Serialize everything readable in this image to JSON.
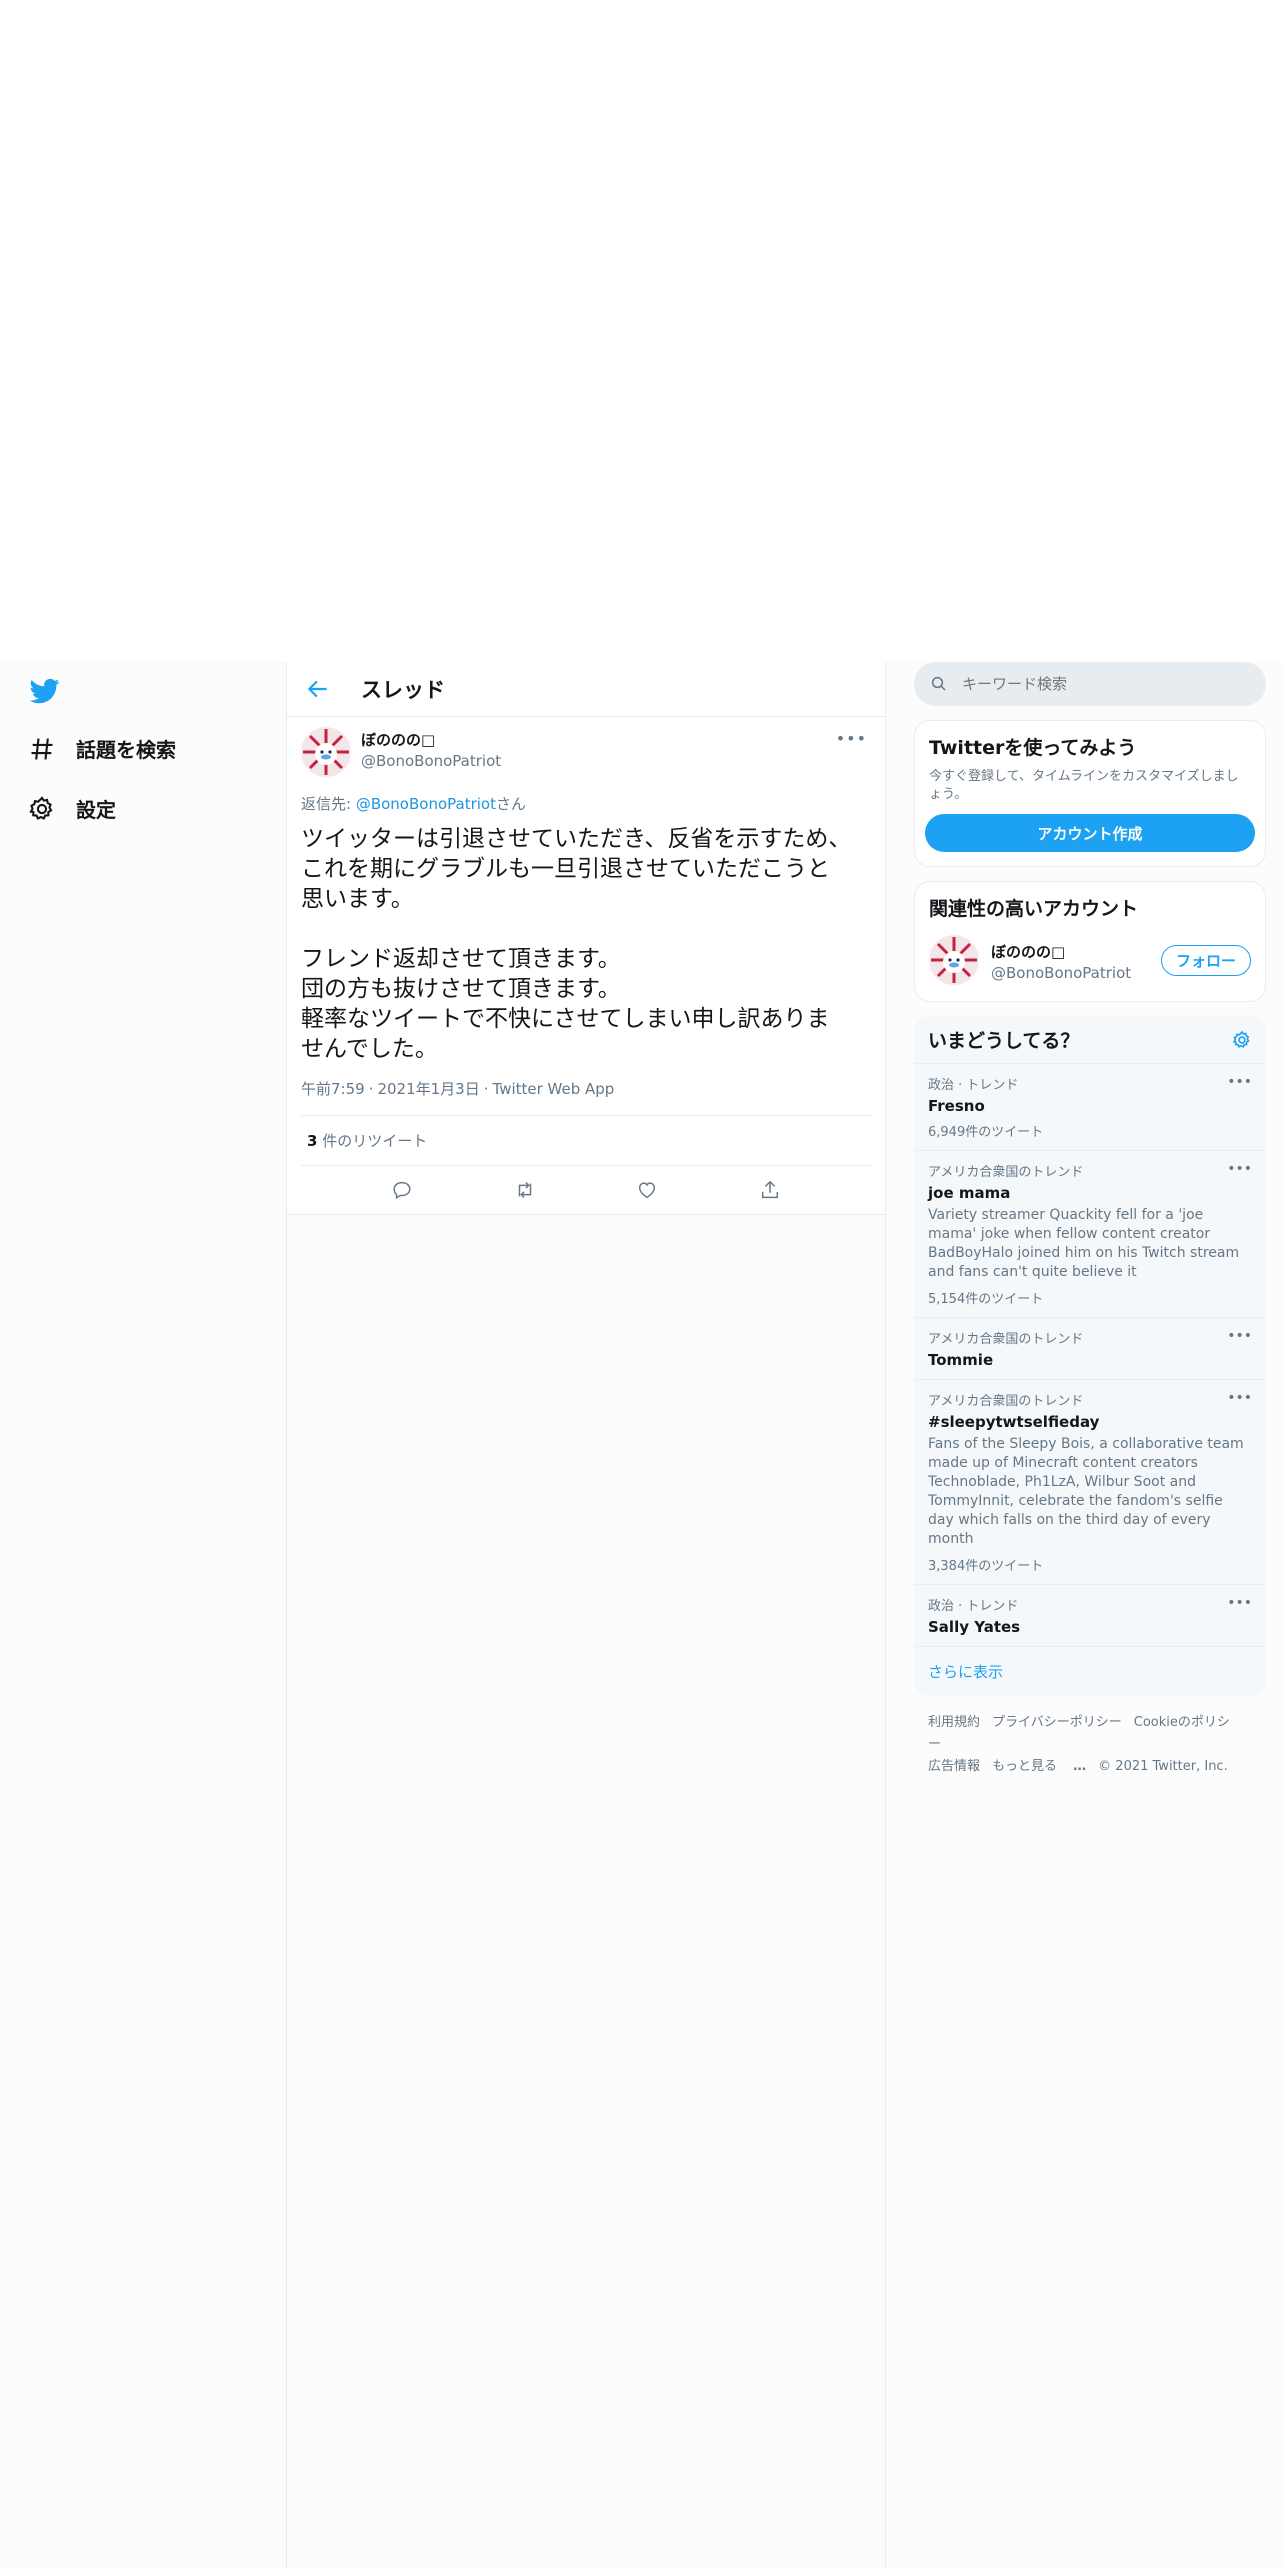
{
  "nav": {
    "explore_label": "話題を検索",
    "settings_label": "設定"
  },
  "thread": {
    "title": "スレッド"
  },
  "tweet": {
    "display_name": "ぼののの□",
    "handle": "@BonoBonoPatriot",
    "reply_prefix": "返信先: ",
    "reply_to": "@BonoBonoPatriot",
    "reply_suffix": "さん",
    "text": "ツイッターは引退させていただき、反省を示すため、\nこれを期にグラブルも一旦引退させていただこうと\n思います。\n\nフレンド返却させて頂きます。\n団の方も抜けさせて頂きます。\n軽率なツイートで不快にさせてしまい申し訳ありま\nせんでした。",
    "time": "午前7:59",
    "date": "2021年1月3日",
    "source": "Twitter Web App",
    "retweet_count": "3",
    "retweet_label": "件のリツイート"
  },
  "search": {
    "placeholder": "キーワード検索"
  },
  "signup": {
    "title": "Twitterを使ってみよう",
    "desc": "今すぐ登録して、タイムラインをカスタマイズしましょう。",
    "button": "アカウント作成"
  },
  "related": {
    "title": "関連性の高いアカウント",
    "display_name": "ぼののの□",
    "handle": "@BonoBonoPatriot",
    "follow": "フォロー"
  },
  "trends": {
    "title": "いまどうしてる？",
    "items": [
      {
        "category": "政治 · トレンド",
        "name": "Fresno",
        "desc": "",
        "count": "6,949件のツイート"
      },
      {
        "category": "アメリカ合衆国のトレンド",
        "name": "joe mama",
        "desc": "Variety streamer Quackity fell for a 'joe mama' joke when fellow content creator BadBoyHalo joined him on his Twitch stream and fans can't quite believe it",
        "count": "5,154件のツイート"
      },
      {
        "category": "アメリカ合衆国のトレンド",
        "name": "Tommie",
        "desc": "",
        "count": ""
      },
      {
        "category": "アメリカ合衆国のトレンド",
        "name": "#sleepytwtselfieday",
        "desc": "Fans of the Sleepy Bois, a collaborative team made up of Minecraft content creators Technoblade, Ph1LzA, Wilbur Soot and TommyInnit, celebrate the fandom's selfie day which falls on the third day of every month",
        "count": "3,384件のツイート"
      },
      {
        "category": "政治 · トレンド",
        "name": "Sally Yates",
        "desc": "",
        "count": ""
      }
    ],
    "show_more": "さらに表示"
  },
  "footer": {
    "terms": "利用規約",
    "privacy": "プライバシーポリシー",
    "cookie": "Cookieのポリシー",
    "ads": "広告情報",
    "more": "もっと見る",
    "copyright": "© 2021 Twitter, Inc."
  },
  "colors": {
    "accent": "#1da1f2",
    "link": "#1b95e0",
    "muted": "#657786"
  }
}
